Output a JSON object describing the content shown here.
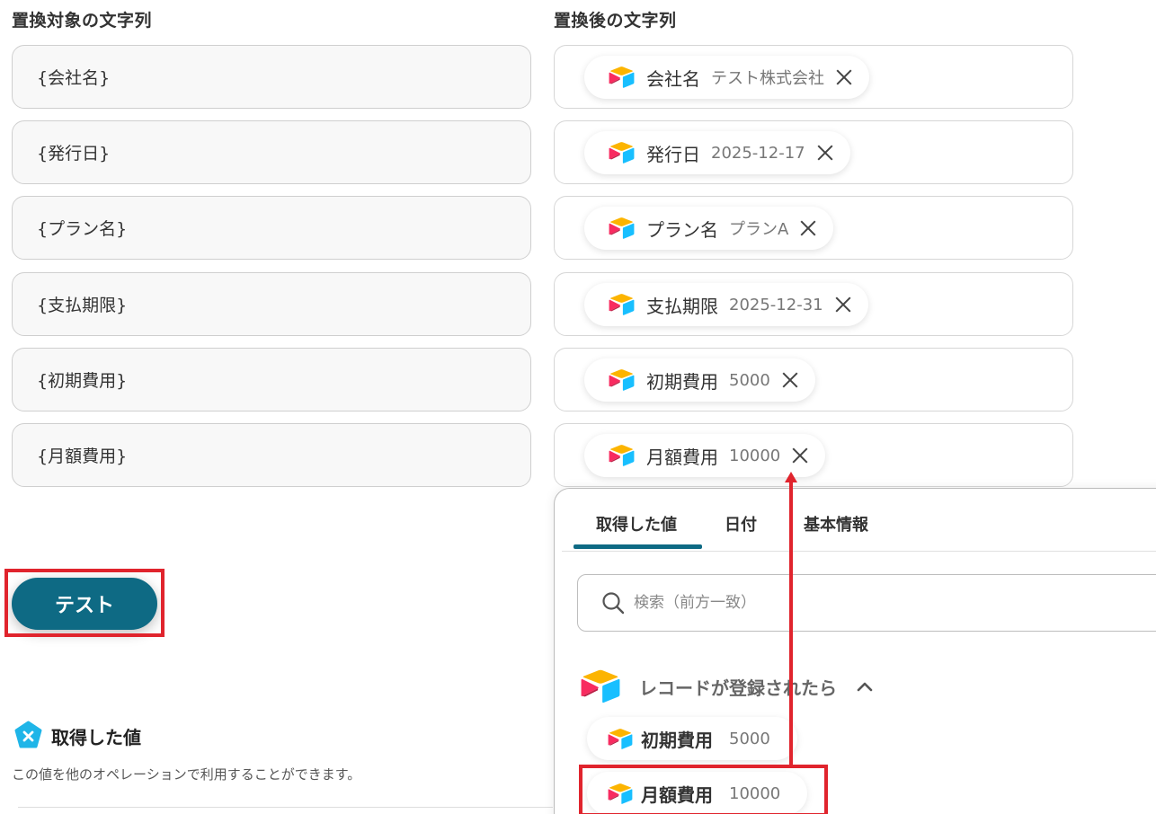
{
  "headers": {
    "source": "置換対象の文字列",
    "target": "置換後の文字列"
  },
  "rows": [
    {
      "source": "{会社名}",
      "name": "会社名",
      "value": "テスト株式会社"
    },
    {
      "source": "{発行日}",
      "name": "発行日",
      "value": "2025-12-17"
    },
    {
      "source": "{プラン名}",
      "name": "プラン名",
      "value": "プランA"
    },
    {
      "source": "{支払期限}",
      "name": "支払期限",
      "value": "2025-12-31"
    },
    {
      "source": "{初期費用}",
      "name": "初期費用",
      "value": "5000"
    },
    {
      "source": "{月額費用}",
      "name": "月額費用",
      "value": "10000"
    }
  ],
  "test_button": "テスト",
  "output_section": {
    "title": "取得した値",
    "description": "この値を他のオペレーションで利用することができます。"
  },
  "panel": {
    "tabs": [
      "取得した値",
      "日付",
      "基本情報"
    ],
    "active_tab": "取得した値",
    "search_placeholder": "検索（前方一致）",
    "group_name": "レコードが登録されたら",
    "items": [
      {
        "name": "初期費用",
        "value": "5000"
      },
      {
        "name": "月額費用",
        "value": "10000"
      }
    ]
  },
  "colors": {
    "accent": "#0e6a84",
    "highlight": "#e0242d"
  }
}
